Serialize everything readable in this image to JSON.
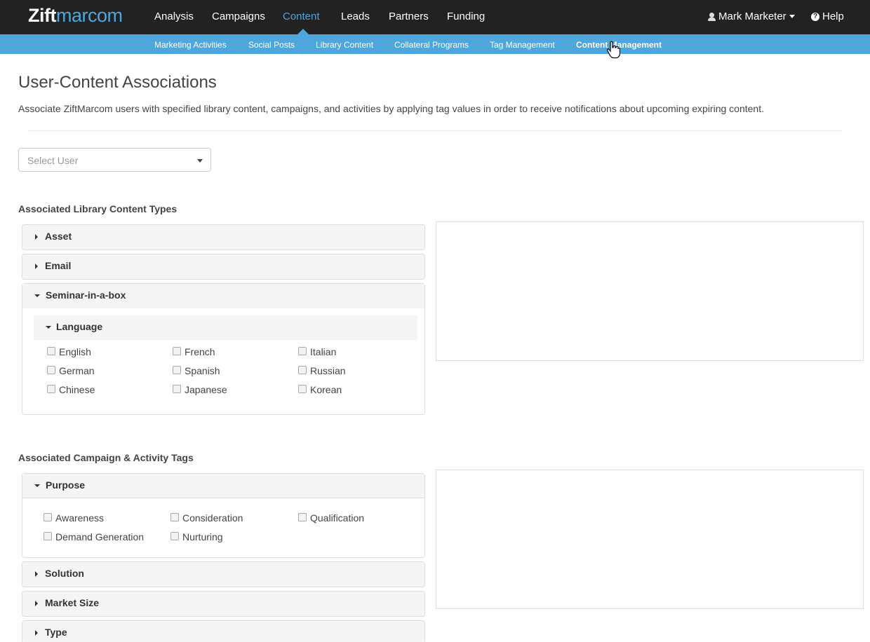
{
  "brand": {
    "logo_part1": "Zift",
    "logo_part2": "marcom"
  },
  "topnav": {
    "items": [
      "Analysis",
      "Campaigns",
      "Content",
      "Leads",
      "Partners",
      "Funding"
    ],
    "active": "Content",
    "user": "Mark Marketer",
    "help": "Help"
  },
  "subnav": {
    "items": [
      "Marketing Activities",
      "Social Posts",
      "Library Content",
      "Collateral Programs",
      "Tag Management",
      "Content Management"
    ],
    "active": "Content Management"
  },
  "page": {
    "title": "User-Content Associations",
    "description": "Associate ZiftMarcom users with specified library content, campaigns, and activities by applying tag values in order to receive notifications about upcoming expiring content.",
    "select_user_placeholder": "Select User"
  },
  "library": {
    "title": "Associated Library Content Types",
    "panels": [
      "Asset",
      "Email",
      "Seminar-in-a-box"
    ],
    "subpanel": "Language",
    "languages": [
      "English",
      "French",
      "Italian",
      "German",
      "Spanish",
      "Russian",
      "Chinese",
      "Japanese",
      "Korean"
    ]
  },
  "campaign": {
    "title": "Associated Campaign & Activity Tags",
    "panels": [
      "Purpose",
      "Solution",
      "Market Size",
      "Type"
    ],
    "purposes": [
      "Awareness",
      "Consideration",
      "Qualification",
      "Demand Generation",
      "Nurturing"
    ]
  },
  "icons": {
    "user": "user-icon",
    "help": "question-circle-icon",
    "collapsed": "caret-right-icon",
    "expanded": "caret-down-icon",
    "cursor": "hand-pointer-icon"
  },
  "colors": {
    "navbar": "#222222",
    "accent": "#4ea6dc"
  }
}
